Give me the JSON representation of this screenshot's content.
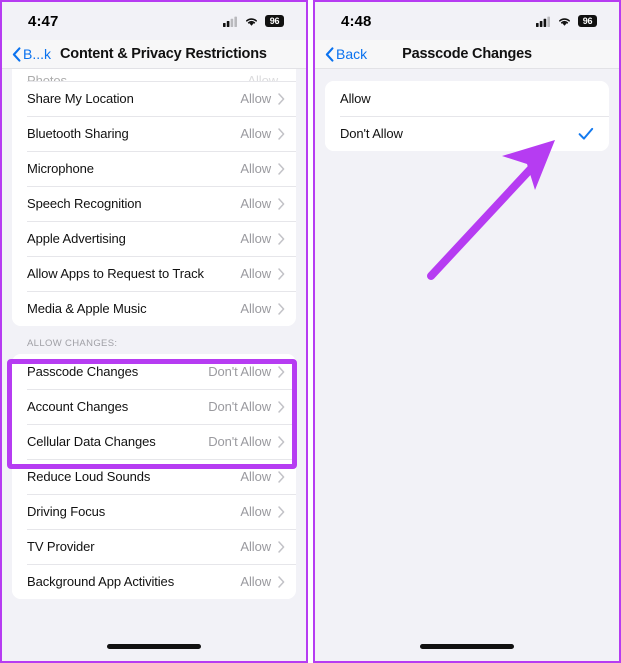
{
  "annotations": {
    "highlight_color": "#b63cf2",
    "arrow_color": "#b63cf2",
    "arrow_points_to": "checkmark-dont-allow",
    "highlight_target": "allow-changes-group"
  },
  "theme": {
    "accent_blue": "#0a72ef",
    "check_blue": "#137aef",
    "value_gray": "#9a9a9f",
    "screen_bg": "#f2f2f7",
    "card_bg": "#ffffff"
  },
  "left_phone": {
    "status_bar": {
      "time": "4:47",
      "cellular_icon": "cellular-signal-icon",
      "wifi_icon": "wifi-icon",
      "battery_icon": "battery-icon",
      "battery_level": "96"
    },
    "nav": {
      "back_icon": "chevron-left-icon",
      "back_label": "B...k",
      "title": "Content & Privacy Restrictions"
    },
    "clipped_row": {
      "label": "Photos",
      "value": "Allow"
    },
    "group_one": [
      {
        "label": "Share My Location",
        "value": "Allow"
      },
      {
        "label": "Bluetooth Sharing",
        "value": "Allow"
      },
      {
        "label": "Microphone",
        "value": "Allow"
      },
      {
        "label": "Speech Recognition",
        "value": "Allow"
      },
      {
        "label": "Apple Advertising",
        "value": "Allow"
      },
      {
        "label": "Allow Apps to Request to Track",
        "value": "Allow"
      },
      {
        "label": "Media & Apple Music",
        "value": "Allow"
      }
    ],
    "section_header": "ALLOW CHANGES:",
    "group_two": [
      {
        "label": "Passcode Changes",
        "value": "Don't Allow"
      },
      {
        "label": "Account Changes",
        "value": "Don't Allow"
      },
      {
        "label": "Cellular Data Changes",
        "value": "Don't Allow"
      },
      {
        "label": "Reduce Loud Sounds",
        "value": "Allow"
      },
      {
        "label": "Driving Focus",
        "value": "Allow"
      },
      {
        "label": "TV Provider",
        "value": "Allow"
      },
      {
        "label": "Background App Activities",
        "value": "Allow"
      }
    ],
    "home_indicator": "home-indicator"
  },
  "right_phone": {
    "status_bar": {
      "time": "4:48",
      "cellular_icon": "cellular-signal-icon",
      "wifi_icon": "wifi-icon",
      "battery_icon": "battery-icon",
      "battery_level": "96"
    },
    "nav": {
      "back_icon": "chevron-left-icon",
      "back_label": "Back",
      "title": "Passcode Changes"
    },
    "options": [
      {
        "label": "Allow",
        "selected": false
      },
      {
        "label": "Don't Allow",
        "selected": true
      }
    ],
    "check_icon": "checkmark-icon",
    "home_indicator": "home-indicator"
  }
}
